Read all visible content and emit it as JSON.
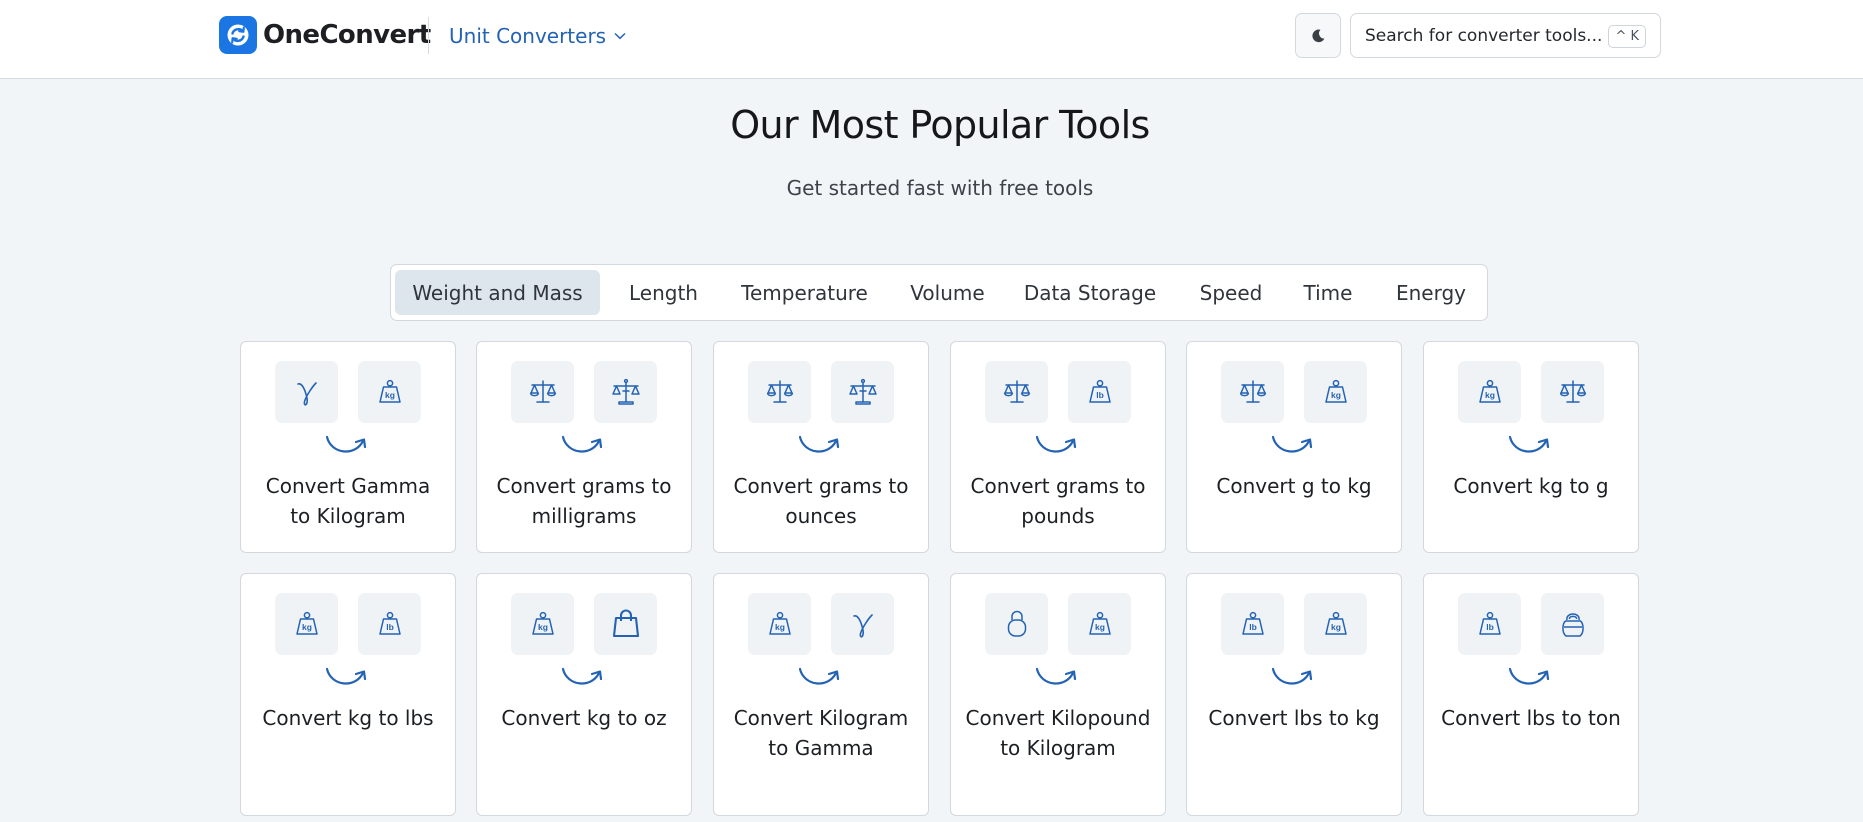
{
  "header": {
    "logo_text": "OneConvert",
    "menu_label": "Unit Converters",
    "search_placeholder": "Search for converter tools...",
    "search_shortcut": "^ K",
    "theme_icon": "moon-icon"
  },
  "hero": {
    "title": "Our Most Popular Tools",
    "subtitle": "Get started fast with free tools"
  },
  "tabs": [
    {
      "label": "Weight and Mass",
      "active": true
    },
    {
      "label": "Length",
      "active": false
    },
    {
      "label": "Temperature",
      "active": false
    },
    {
      "label": "Volume",
      "active": false
    },
    {
      "label": "Data Storage",
      "active": false
    },
    {
      "label": "Speed",
      "active": false
    },
    {
      "label": "Time",
      "active": false
    },
    {
      "label": "Energy",
      "active": false
    }
  ],
  "cards": [
    {
      "label": "Convert Gamma to Kilogram",
      "from_icon": "gamma",
      "to_icon": "kg-weight"
    },
    {
      "label": "Convert grams to milligrams",
      "from_icon": "scale",
      "to_icon": "scale-stand"
    },
    {
      "label": "Convert grams to ounces",
      "from_icon": "scale",
      "to_icon": "scale-stand"
    },
    {
      "label": "Convert grams to pounds",
      "from_icon": "scale",
      "to_icon": "lb-weight"
    },
    {
      "label": "Convert g to kg",
      "from_icon": "scale",
      "to_icon": "kg-weight"
    },
    {
      "label": "Convert kg to g",
      "from_icon": "kg-weight",
      "to_icon": "scale"
    },
    {
      "label": "Convert kg to lbs",
      "from_icon": "kg-weight",
      "to_icon": "lb-weight"
    },
    {
      "label": "Convert kg to oz",
      "from_icon": "kg-weight",
      "to_icon": "bag"
    },
    {
      "label": "Convert Kilogram to Gamma",
      "from_icon": "kg-weight",
      "to_icon": "gamma"
    },
    {
      "label": "Convert Kilopound to Kilogram",
      "from_icon": "padlock-weight",
      "to_icon": "kg-weight"
    },
    {
      "label": "Convert lbs to kg",
      "from_icon": "lb-weight",
      "to_icon": "kg-weight"
    },
    {
      "label": "Convert lbs to ton",
      "from_icon": "lb-weight",
      "to_icon": "kettlebell"
    }
  ],
  "colors": {
    "accent": "#1b76e4",
    "icon": "#2463b4",
    "page_bg": "#f2f5f8",
    "active_tab_bg": "#dee6ed"
  }
}
